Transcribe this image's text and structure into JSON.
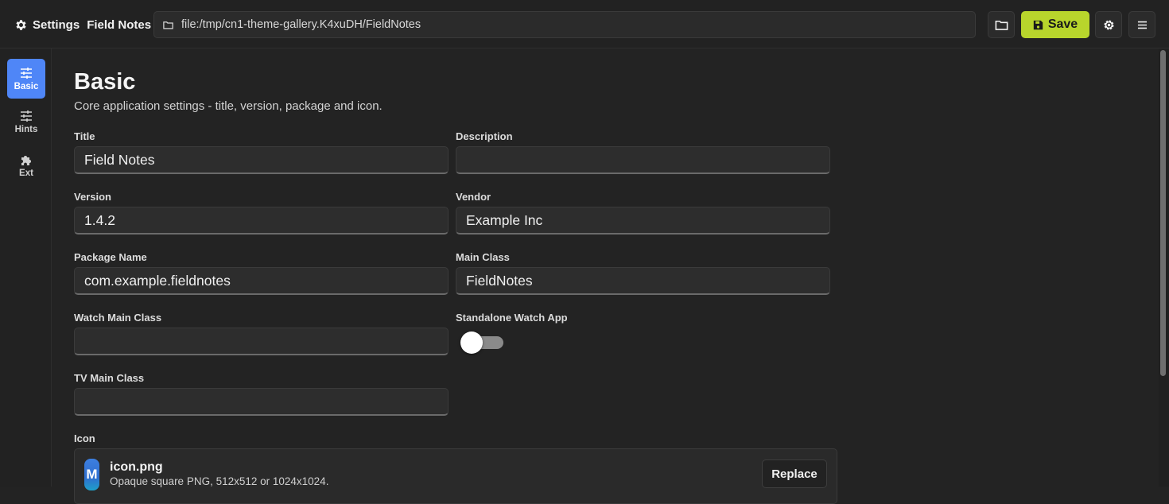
{
  "header": {
    "settings_label": "Settings",
    "app_name": "Field Notes",
    "path": "file:/tmp/cn1-theme-gallery.K4xuDH/FieldNotes",
    "save_label": "Save",
    "save_color": "#b8d52c"
  },
  "sidebar": {
    "items": [
      {
        "label": "Basic",
        "icon": "sliders-icon",
        "active": true
      },
      {
        "label": "Hints",
        "icon": "sliders-icon",
        "active": false
      },
      {
        "label": "Ext",
        "icon": "puzzle-icon",
        "active": false
      }
    ],
    "active_color": "#4f86f7"
  },
  "main": {
    "title": "Basic",
    "subtitle": "Core application settings - title, version, package and icon.",
    "fields": {
      "title": {
        "label": "Title",
        "value": "Field Notes"
      },
      "description": {
        "label": "Description",
        "value": ""
      },
      "version": {
        "label": "Version",
        "value": "1.4.2"
      },
      "vendor": {
        "label": "Vendor",
        "value": "Example Inc"
      },
      "package_name": {
        "label": "Package Name",
        "value": "com.example.fieldnotes"
      },
      "main_class": {
        "label": "Main Class",
        "value": "FieldNotes"
      },
      "watch_main_class": {
        "label": "Watch Main Class",
        "value": ""
      },
      "standalone_watch_app": {
        "label": "Standalone Watch App",
        "value": false
      },
      "tv_main_class": {
        "label": "TV Main Class",
        "value": ""
      }
    },
    "icon": {
      "label": "Icon",
      "glyph": "M",
      "file_name": "icon.png",
      "hint": "Opaque square PNG, 512x512 or 1024x1024.",
      "replace_label": "Replace"
    }
  }
}
